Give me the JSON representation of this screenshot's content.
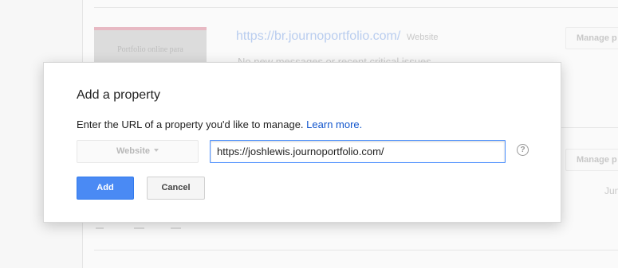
{
  "background": {
    "site_url": "https://br.journoportfolio.com/",
    "site_type": "Website",
    "site_message": "No new messages or recent critical issues",
    "thumbnail_text": "Portfolio online para",
    "manage_label": "Manage p",
    "date_fragment": "Jun"
  },
  "dialog": {
    "title": "Add a property",
    "description": "Enter the URL of a property you'd like to manage.",
    "learn_more": "Learn more.",
    "property_type": "Website",
    "url_value": "https://joshlewis.journoportfolio.com/",
    "help_icon_glyph": "?",
    "add_label": "Add",
    "cancel_label": "Cancel"
  },
  "colors": {
    "accent": "#4a8af4",
    "link": "#1155cc",
    "input_focus": "#4d90fe"
  }
}
